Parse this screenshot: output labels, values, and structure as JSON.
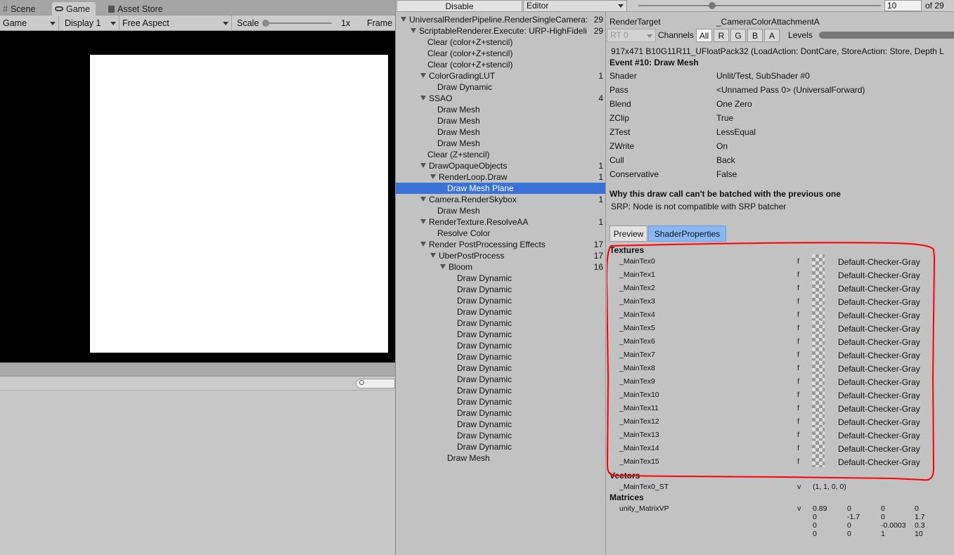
{
  "game_window": {
    "tabs": [
      {
        "icon": "hash-icon",
        "label": "Scene"
      },
      {
        "icon": "gamepad-icon",
        "label": "Game"
      },
      {
        "icon": "store-icon",
        "label": "Asset Store"
      }
    ],
    "toolbar": {
      "view_dropdown": "Game",
      "display_dropdown": "Display 1",
      "aspect_dropdown": "Free Aspect",
      "scale_label": "Scale",
      "scale_value": "1x",
      "frame_label": "Frame"
    }
  },
  "frame_debugger": {
    "toolbar": {
      "disable_button": "Disable",
      "target_dropdown": "Editor",
      "event_index": "10",
      "event_total": "of 29"
    },
    "tree": [
      {
        "label": "UniversalRenderPipeline.RenderSingleCamera:",
        "count": "29",
        "depth": 0,
        "expanded": true
      },
      {
        "label": "ScriptableRenderer.Execute: URP-HighFideli",
        "count": "29",
        "depth": 1,
        "expanded": true
      },
      {
        "label": "Clear (color+Z+stencil)",
        "count": "",
        "depth": 2
      },
      {
        "label": "Clear (color+Z+stencil)",
        "count": "",
        "depth": 2
      },
      {
        "label": "Clear (color+Z+stencil)",
        "count": "",
        "depth": 2
      },
      {
        "label": "ColorGradingLUT",
        "count": "1",
        "depth": 2,
        "expanded": true
      },
      {
        "label": "Draw Dynamic",
        "count": "",
        "depth": 3
      },
      {
        "label": "SSAO",
        "count": "4",
        "depth": 2,
        "expanded": true
      },
      {
        "label": "Draw Mesh",
        "count": "",
        "depth": 3
      },
      {
        "label": "Draw Mesh",
        "count": "",
        "depth": 3
      },
      {
        "label": "Draw Mesh",
        "count": "",
        "depth": 3
      },
      {
        "label": "Draw Mesh",
        "count": "",
        "depth": 3
      },
      {
        "label": "Clear (Z+stencil)",
        "count": "",
        "depth": 2
      },
      {
        "label": "DrawOpaqueObjects",
        "count": "1",
        "depth": 2,
        "expanded": true
      },
      {
        "label": "RenderLoop.Draw",
        "count": "1",
        "depth": 3,
        "expanded": true
      },
      {
        "label": "Draw Mesh Plane",
        "count": "",
        "depth": 4,
        "selected": true
      },
      {
        "label": "Camera.RenderSkybox",
        "count": "1",
        "depth": 2,
        "expanded": true
      },
      {
        "label": "Draw Mesh",
        "count": "",
        "depth": 3
      },
      {
        "label": "RenderTexture.ResolveAA",
        "count": "1",
        "depth": 2,
        "expanded": true
      },
      {
        "label": "Resolve Color",
        "count": "",
        "depth": 3
      },
      {
        "label": "Render PostProcessing Effects",
        "count": "17",
        "depth": 2,
        "expanded": true
      },
      {
        "label": "UberPostProcess",
        "count": "17",
        "depth": 3,
        "expanded": true
      },
      {
        "label": "Bloom",
        "count": "16",
        "depth": 4,
        "expanded": true
      },
      {
        "label": "Draw Dynamic",
        "count": "",
        "depth": 5
      },
      {
        "label": "Draw Dynamic",
        "count": "",
        "depth": 5
      },
      {
        "label": "Draw Dynamic",
        "count": "",
        "depth": 5
      },
      {
        "label": "Draw Dynamic",
        "count": "",
        "depth": 5
      },
      {
        "label": "Draw Dynamic",
        "count": "",
        "depth": 5
      },
      {
        "label": "Draw Dynamic",
        "count": "",
        "depth": 5
      },
      {
        "label": "Draw Dynamic",
        "count": "",
        "depth": 5
      },
      {
        "label": "Draw Dynamic",
        "count": "",
        "depth": 5
      },
      {
        "label": "Draw Dynamic",
        "count": "",
        "depth": 5
      },
      {
        "label": "Draw Dynamic",
        "count": "",
        "depth": 5
      },
      {
        "label": "Draw Dynamic",
        "count": "",
        "depth": 5
      },
      {
        "label": "Draw Dynamic",
        "count": "",
        "depth": 5
      },
      {
        "label": "Draw Dynamic",
        "count": "",
        "depth": 5
      },
      {
        "label": "Draw Dynamic",
        "count": "",
        "depth": 5
      },
      {
        "label": "Draw Dynamic",
        "count": "",
        "depth": 5
      },
      {
        "label": "Draw Dynamic",
        "count": "",
        "depth": 5
      },
      {
        "label": "Draw Mesh",
        "count": "",
        "depth": 4
      }
    ],
    "detail": {
      "render_target_label": "RenderTarget",
      "render_target_value": "_CameraColorAttachmentA",
      "rt_dropdown": "RT 0",
      "channels_label": "Channels",
      "channels": [
        "All",
        "R",
        "G",
        "B",
        "A"
      ],
      "levels_label": "Levels",
      "format_line": "917x471 B10G11R11_UFloatPack32 (LoadAction: DontCare, StoreAction: Store, Depth L",
      "event_title": "Event #10: Draw Mesh",
      "properties": [
        {
          "key": "Shader",
          "value": "Unlit/Test, SubShader #0"
        },
        {
          "key": "Pass",
          "value": "<Unnamed Pass 0> (UniversalForward)"
        },
        {
          "key": "Blend",
          "value": "One Zero"
        },
        {
          "key": "ZClip",
          "value": "True"
        },
        {
          "key": "ZTest",
          "value": "LessEqual"
        },
        {
          "key": "ZWrite",
          "value": "On"
        },
        {
          "key": "Cull",
          "value": "Back"
        },
        {
          "key": "Conservative",
          "value": "False"
        }
      ],
      "batch_title": "Why this draw call can't be batched with the previous one",
      "batch_reason": "SRP: Node is not compatible with SRP batcher",
      "tabs": [
        "Preview",
        "ShaderProperties"
      ],
      "textures_header": "Textures",
      "textures": [
        {
          "name": "_MainTex0",
          "stage": "f",
          "value": "Default-Checker-Gray"
        },
        {
          "name": "_MainTex1",
          "stage": "f",
          "value": "Default-Checker-Gray"
        },
        {
          "name": "_MainTex2",
          "stage": "f",
          "value": "Default-Checker-Gray"
        },
        {
          "name": "_MainTex3",
          "stage": "f",
          "value": "Default-Checker-Gray"
        },
        {
          "name": "_MainTex4",
          "stage": "f",
          "value": "Default-Checker-Gray"
        },
        {
          "name": "_MainTex5",
          "stage": "f",
          "value": "Default-Checker-Gray"
        },
        {
          "name": "_MainTex6",
          "stage": "f",
          "value": "Default-Checker-Gray"
        },
        {
          "name": "_MainTex7",
          "stage": "f",
          "value": "Default-Checker-Gray"
        },
        {
          "name": "_MainTex8",
          "stage": "f",
          "value": "Default-Checker-Gray"
        },
        {
          "name": "_MainTex9",
          "stage": "f",
          "value": "Default-Checker-Gray"
        },
        {
          "name": "_MainTex10",
          "stage": "f",
          "value": "Default-Checker-Gray"
        },
        {
          "name": "_MainTex11",
          "stage": "f",
          "value": "Default-Checker-Gray"
        },
        {
          "name": "_MainTex12",
          "stage": "f",
          "value": "Default-Checker-Gray"
        },
        {
          "name": "_MainTex13",
          "stage": "f",
          "value": "Default-Checker-Gray"
        },
        {
          "name": "_MainTex14",
          "stage": "f",
          "value": "Default-Checker-Gray"
        },
        {
          "name": "_MainTex15",
          "stage": "f",
          "value": "Default-Checker-Gray"
        }
      ],
      "vectors_header": "Vectors",
      "vectors": [
        {
          "name": "_MainTex0_ST",
          "stage": "v",
          "value": "(1, 1, 0, 0)"
        }
      ],
      "matrices_header": "Matrices",
      "matrix_name": "unity_MatrixVP",
      "matrix_stage": "v",
      "matrix": [
        [
          "0.89",
          "0",
          "0",
          "0"
        ],
        [
          "0",
          "-1.7",
          "0",
          "1.7"
        ],
        [
          "0",
          "0",
          "-0.0003",
          "0.3"
        ],
        [
          "0",
          "0",
          "1",
          "10"
        ]
      ]
    }
  },
  "colors": {
    "selection": "#3a72d8",
    "active_tab": "#8ab8f5",
    "annotation": "#ff0000"
  }
}
